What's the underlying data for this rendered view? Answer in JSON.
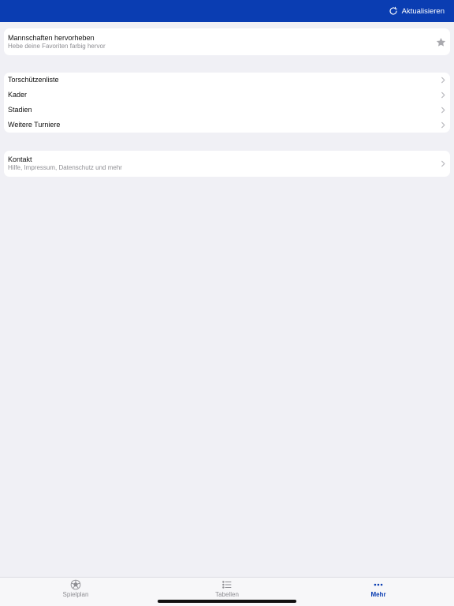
{
  "navbar": {
    "refresh_label": "Aktualisieren",
    "refresh_icon": "refresh-icon",
    "background_color": "#0a3db2"
  },
  "highlight": {
    "title": "Mannschaften hervorheben",
    "subtitle": "Hebe deine Favoriten farbig hervor",
    "icon": "star-icon"
  },
  "list": {
    "items": [
      {
        "label": "Torschützenliste"
      },
      {
        "label": "Kader"
      },
      {
        "label": "Stadien"
      },
      {
        "label": "Weitere Turniere"
      }
    ]
  },
  "contact": {
    "title": "Kontakt",
    "subtitle": "Hilfe, Impressum, Datenschutz und mehr"
  },
  "tabbar": {
    "tabs": [
      {
        "label": "Spielplan",
        "icon": "soccer-ball-icon",
        "active": false
      },
      {
        "label": "Tabellen",
        "icon": "list-icon",
        "active": false
      },
      {
        "label": "Mehr",
        "icon": "more-icon",
        "active": true
      }
    ],
    "active_color": "#0a3db2"
  }
}
